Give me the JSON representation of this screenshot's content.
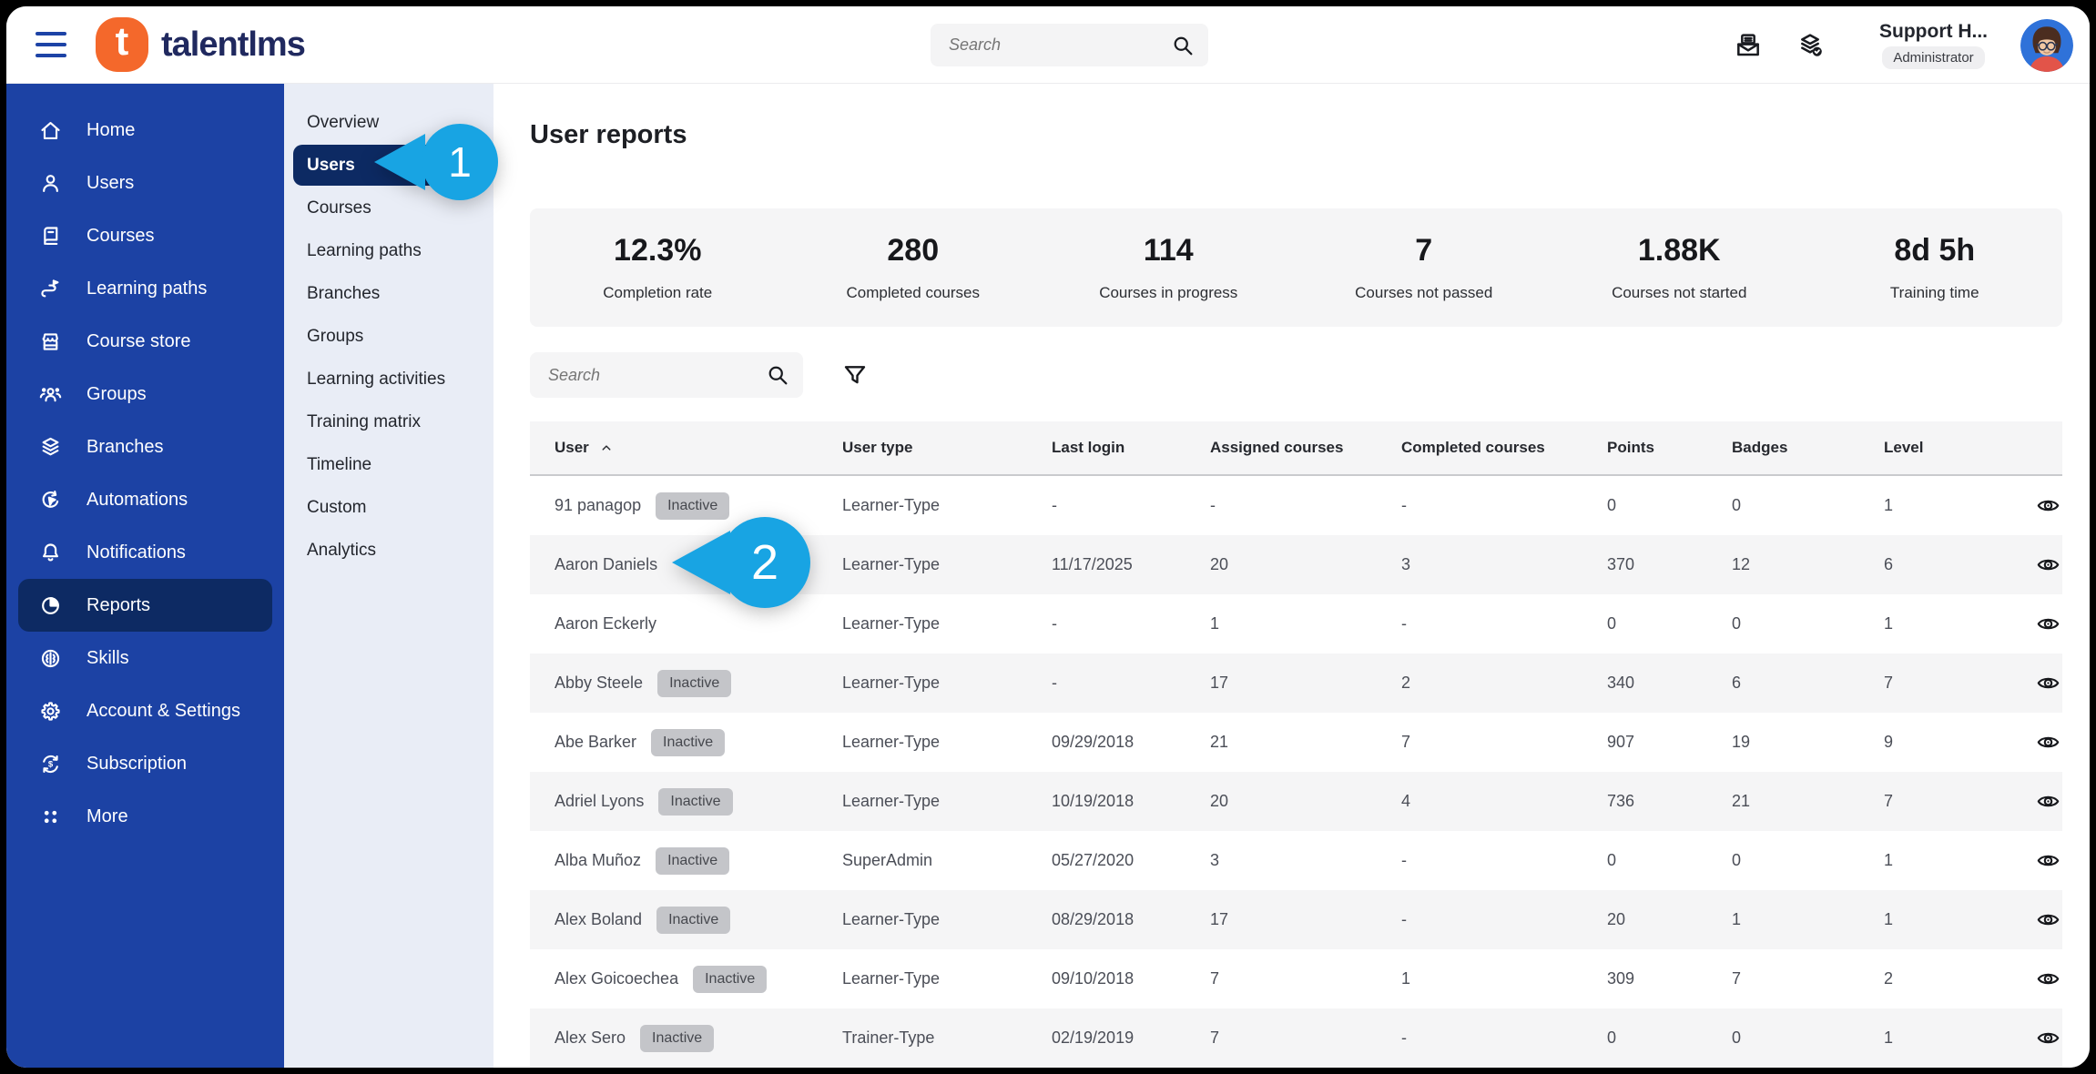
{
  "topbar": {
    "logo_letter": "t",
    "brand_text": "talentlms",
    "search_placeholder": "Search",
    "user_name": "Support H...",
    "user_role": "Administrator"
  },
  "sidebar": {
    "items": [
      {
        "label": "Home",
        "icon": "home-icon",
        "active": false
      },
      {
        "label": "Users",
        "icon": "users-icon",
        "active": false
      },
      {
        "label": "Courses",
        "icon": "courses-icon",
        "active": false
      },
      {
        "label": "Learning paths",
        "icon": "learning-paths-icon",
        "active": false
      },
      {
        "label": "Course store",
        "icon": "course-store-icon",
        "active": false
      },
      {
        "label": "Groups",
        "icon": "groups-icon",
        "active": false
      },
      {
        "label": "Branches",
        "icon": "branches-icon",
        "active": false
      },
      {
        "label": "Automations",
        "icon": "automations-icon",
        "active": false
      },
      {
        "label": "Notifications",
        "icon": "notifications-icon",
        "active": false
      },
      {
        "label": "Reports",
        "icon": "reports-icon",
        "active": true
      },
      {
        "label": "Skills",
        "icon": "skills-icon",
        "active": false
      },
      {
        "label": "Account & Settings",
        "icon": "settings-icon",
        "active": false
      },
      {
        "label": "Subscription",
        "icon": "subscription-icon",
        "active": false
      },
      {
        "label": "More",
        "icon": "more-icon",
        "active": false
      }
    ]
  },
  "subnav": {
    "items": [
      {
        "label": "Overview",
        "active": false
      },
      {
        "label": "Users",
        "active": true
      },
      {
        "label": "Courses",
        "active": false
      },
      {
        "label": "Learning paths",
        "active": false
      },
      {
        "label": "Branches",
        "active": false
      },
      {
        "label": "Groups",
        "active": false
      },
      {
        "label": "Learning activities",
        "active": false
      },
      {
        "label": "Training matrix",
        "active": false
      },
      {
        "label": "Timeline",
        "active": false
      },
      {
        "label": "Custom",
        "active": false
      },
      {
        "label": "Analytics",
        "active": false
      }
    ]
  },
  "page": {
    "title": "User reports"
  },
  "stats": [
    {
      "value": "12.3%",
      "label": "Completion rate"
    },
    {
      "value": "280",
      "label": "Completed courses"
    },
    {
      "value": "114",
      "label": "Courses in progress"
    },
    {
      "value": "7",
      "label": "Courses not passed"
    },
    {
      "value": "1.88K",
      "label": "Courses not started"
    },
    {
      "value": "8d 5h",
      "label": "Training time"
    }
  ],
  "table": {
    "search_placeholder": "Search",
    "columns": [
      "User",
      "User type",
      "Last login",
      "Assigned courses",
      "Completed courses",
      "Points",
      "Badges",
      "Level"
    ],
    "sorted_by": "User",
    "sort_direction": "asc",
    "inactive_badge_label": "Inactive",
    "row_action_icon": "eye-icon",
    "rows": [
      {
        "name": "91 panagop",
        "inactive": true,
        "user_type": "Learner-Type",
        "last_login": "-",
        "assigned_courses": "-",
        "completed_courses": "-",
        "points": "0",
        "badges": "0",
        "level": "1"
      },
      {
        "name": "Aaron Daniels",
        "inactive": false,
        "user_type": "Learner-Type",
        "last_login": "11/17/2025",
        "assigned_courses": "20",
        "completed_courses": "3",
        "points": "370",
        "badges": "12",
        "level": "6"
      },
      {
        "name": "Aaron Eckerly",
        "inactive": false,
        "user_type": "Learner-Type",
        "last_login": "-",
        "assigned_courses": "1",
        "completed_courses": "-",
        "points": "0",
        "badges": "0",
        "level": "1"
      },
      {
        "name": "Abby Steele",
        "inactive": true,
        "user_type": "Learner-Type",
        "last_login": "-",
        "assigned_courses": "17",
        "completed_courses": "2",
        "points": "340",
        "badges": "6",
        "level": "7"
      },
      {
        "name": "Abe Barker",
        "inactive": true,
        "user_type": "Learner-Type",
        "last_login": "09/29/2018",
        "assigned_courses": "21",
        "completed_courses": "7",
        "points": "907",
        "badges": "19",
        "level": "9"
      },
      {
        "name": "Adriel Lyons",
        "inactive": true,
        "user_type": "Learner-Type",
        "last_login": "10/19/2018",
        "assigned_courses": "20",
        "completed_courses": "4",
        "points": "736",
        "badges": "21",
        "level": "7"
      },
      {
        "name": "Alba Muñoz",
        "inactive": true,
        "user_type": "SuperAdmin",
        "last_login": "05/27/2020",
        "assigned_courses": "3",
        "completed_courses": "-",
        "points": "0",
        "badges": "0",
        "level": "1"
      },
      {
        "name": "Alex Boland",
        "inactive": true,
        "user_type": "Learner-Type",
        "last_login": "08/29/2018",
        "assigned_courses": "17",
        "completed_courses": "-",
        "points": "20",
        "badges": "1",
        "level": "1"
      },
      {
        "name": "Alex Goicoechea",
        "inactive": true,
        "user_type": "Learner-Type",
        "last_login": "09/10/2018",
        "assigned_courses": "7",
        "completed_courses": "1",
        "points": "309",
        "badges": "7",
        "level": "2"
      },
      {
        "name": "Alex Sero",
        "inactive": true,
        "user_type": "Trainer-Type",
        "last_login": "02/19/2019",
        "assigned_courses": "7",
        "completed_courses": "-",
        "points": "0",
        "badges": "0",
        "level": "1"
      }
    ]
  },
  "callouts": [
    {
      "number": "1"
    },
    {
      "number": "2"
    }
  ],
  "colors": {
    "sidebar_blue": "#1c42a4",
    "active_navy": "#0d2a63",
    "subnav_bg": "#e9edf6",
    "callout_blue": "#18a4e3",
    "brand_orange": "#f4682b",
    "brand_navy": "#20295f",
    "panel_gray": "#f5f5f6",
    "badge_gray": "#c4c5c9"
  }
}
